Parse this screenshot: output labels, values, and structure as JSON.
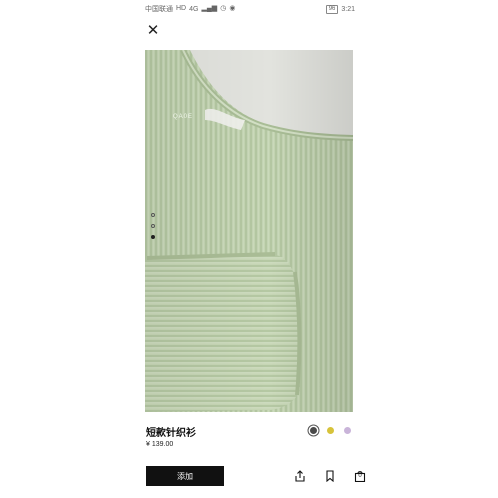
{
  "status_bar": {
    "carrier": "中国联通",
    "network": "4G",
    "battery": "96",
    "time": "3:21",
    "icons": [
      "hd-icon",
      "signal-icon",
      "alarm-icon",
      "app-icon",
      "battery-icon"
    ]
  },
  "header": {
    "close_icon": "close-icon"
  },
  "gallery": {
    "tag_text": "QA0E",
    "page_count": 3,
    "active_page": 3
  },
  "product": {
    "name": "短款针织衫",
    "price": "¥ 139.00",
    "colors": [
      {
        "name": "dark-gray",
        "hex": "#4a4a4a",
        "selected": true
      },
      {
        "name": "yellow",
        "hex": "#d7c33a",
        "selected": false
      },
      {
        "name": "lilac",
        "hex": "#c9b4d9",
        "selected": false
      }
    ]
  },
  "actions": {
    "add_label": "添加",
    "share_icon": "share-icon",
    "wishlist_icon": "bookmark-icon",
    "bag_icon": "bag-icon",
    "bag_count": "0"
  }
}
